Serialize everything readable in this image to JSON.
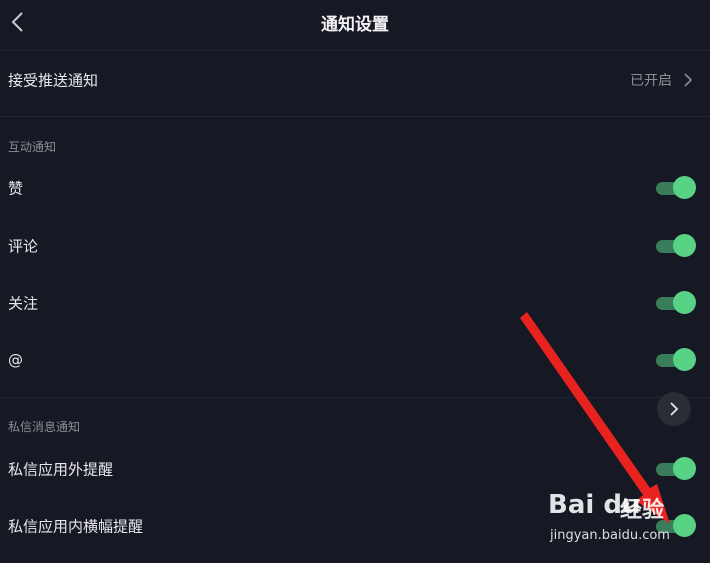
{
  "header": {
    "title": "通知设置",
    "back_icon": "chevron-left-icon"
  },
  "push": {
    "label": "接受推送通知",
    "value": "已开启"
  },
  "interaction": {
    "section_title": "互动通知",
    "items": [
      {
        "label": "赞",
        "enabled": true
      },
      {
        "label": "评论",
        "enabled": true
      },
      {
        "label": "关注",
        "enabled": true
      },
      {
        "label": "@",
        "enabled": true
      }
    ]
  },
  "messages": {
    "section_title": "私信消息通知",
    "items": [
      {
        "label": "私信应用外提醒",
        "enabled": true
      },
      {
        "label": "私信应用内横幅提醒",
        "enabled": true
      }
    ]
  },
  "watermark": {
    "logo": "Bai du",
    "cn": "经验",
    "url": "jingyan.baidu.com"
  },
  "colors": {
    "background": "#161823",
    "toggle_on_knob": "#58d386",
    "toggle_on_track": "#3a7d5a",
    "annotation_arrow": "#e8231f"
  }
}
